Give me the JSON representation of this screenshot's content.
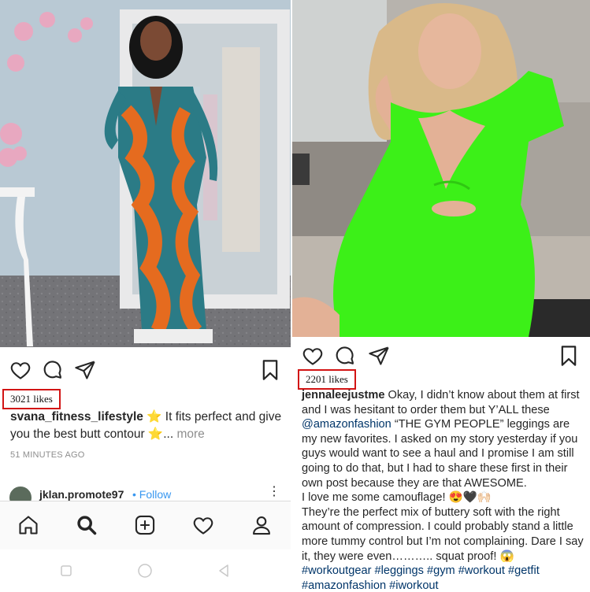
{
  "left_post": {
    "likes": "3021 likes",
    "username": "svana_fitness_lifestyle",
    "caption_text": "⭐ It fits perfect and give you the best butt contour ⭐...",
    "more_label": " more",
    "timestamp": "51 MINUTES AGO",
    "next_username": "jklan.promote97",
    "next_follow": "• Follow",
    "next_menu": "⋮"
  },
  "right_post": {
    "likes": "2201 likes",
    "username": "jennaleejustme",
    "caption_1": " Okay, I didn’t know about them at first and I was hesitant to order them but Y’ALL these ",
    "mention": "@amazonfashion",
    "caption_2": " “THE GYM PEOPLE” leggings are my new favorites. I asked on my story yesterday if you guys would want to see a haul and I promise I am still going to do that, but I had to share these first in their own post because they are that AWESOME.",
    "caption_3": "I love me some camouflage! 😍🖤🙌🏻",
    "caption_4": "They’re the perfect mix of buttery soft with the right amount of compression. I could probably stand a little more tummy control but I’m not complaining. Dare I say it, they were even……….. squat proof! 😱",
    "hashtags_1": "#workoutgear #leggings #gym #workout #getfit",
    "hashtags_2": "#amazonfashion #iworkout"
  },
  "icons": {
    "like": "heart-icon",
    "comment": "comment-icon",
    "share": "send-icon",
    "save": "bookmark-icon",
    "home": "home-icon",
    "search": "search-icon",
    "add": "add-post-icon",
    "activity": "heart-icon",
    "profile": "profile-icon"
  },
  "colors": {
    "likes_highlight": "#d21414",
    "link": "#003569",
    "follow": "#3897f0",
    "dress_green": "#3cf018"
  }
}
